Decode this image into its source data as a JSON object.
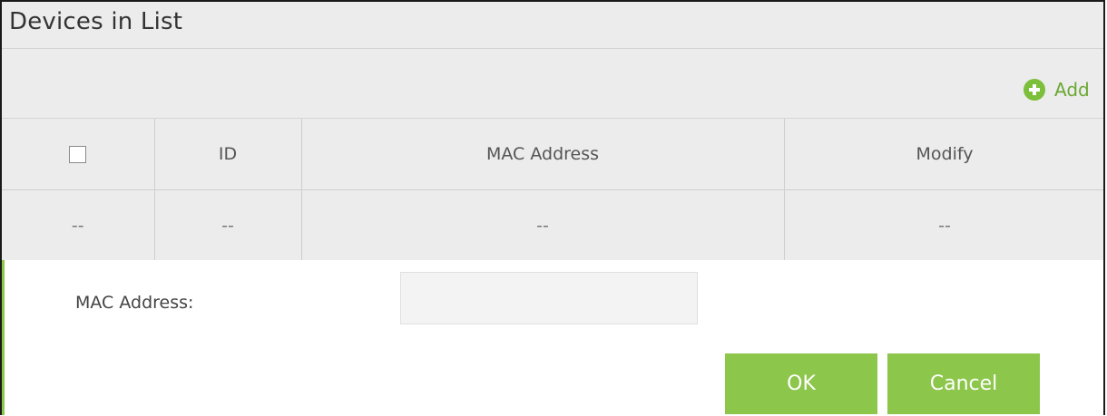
{
  "section": {
    "title": "Devices in List"
  },
  "toolbar": {
    "add_label": "Add",
    "add_icon": "plus-circle-icon",
    "accent_color": "#8cc64b"
  },
  "table": {
    "headers": {
      "select": "",
      "id": "ID",
      "mac": "MAC Address",
      "modify": "Modify"
    },
    "rows": [
      {
        "select": "--",
        "id": "--",
        "mac": "--",
        "modify": "--"
      }
    ]
  },
  "form": {
    "mac_label": "MAC Address:",
    "mac_value": "",
    "mac_placeholder": "",
    "ok_label": "OK",
    "cancel_label": "Cancel"
  }
}
